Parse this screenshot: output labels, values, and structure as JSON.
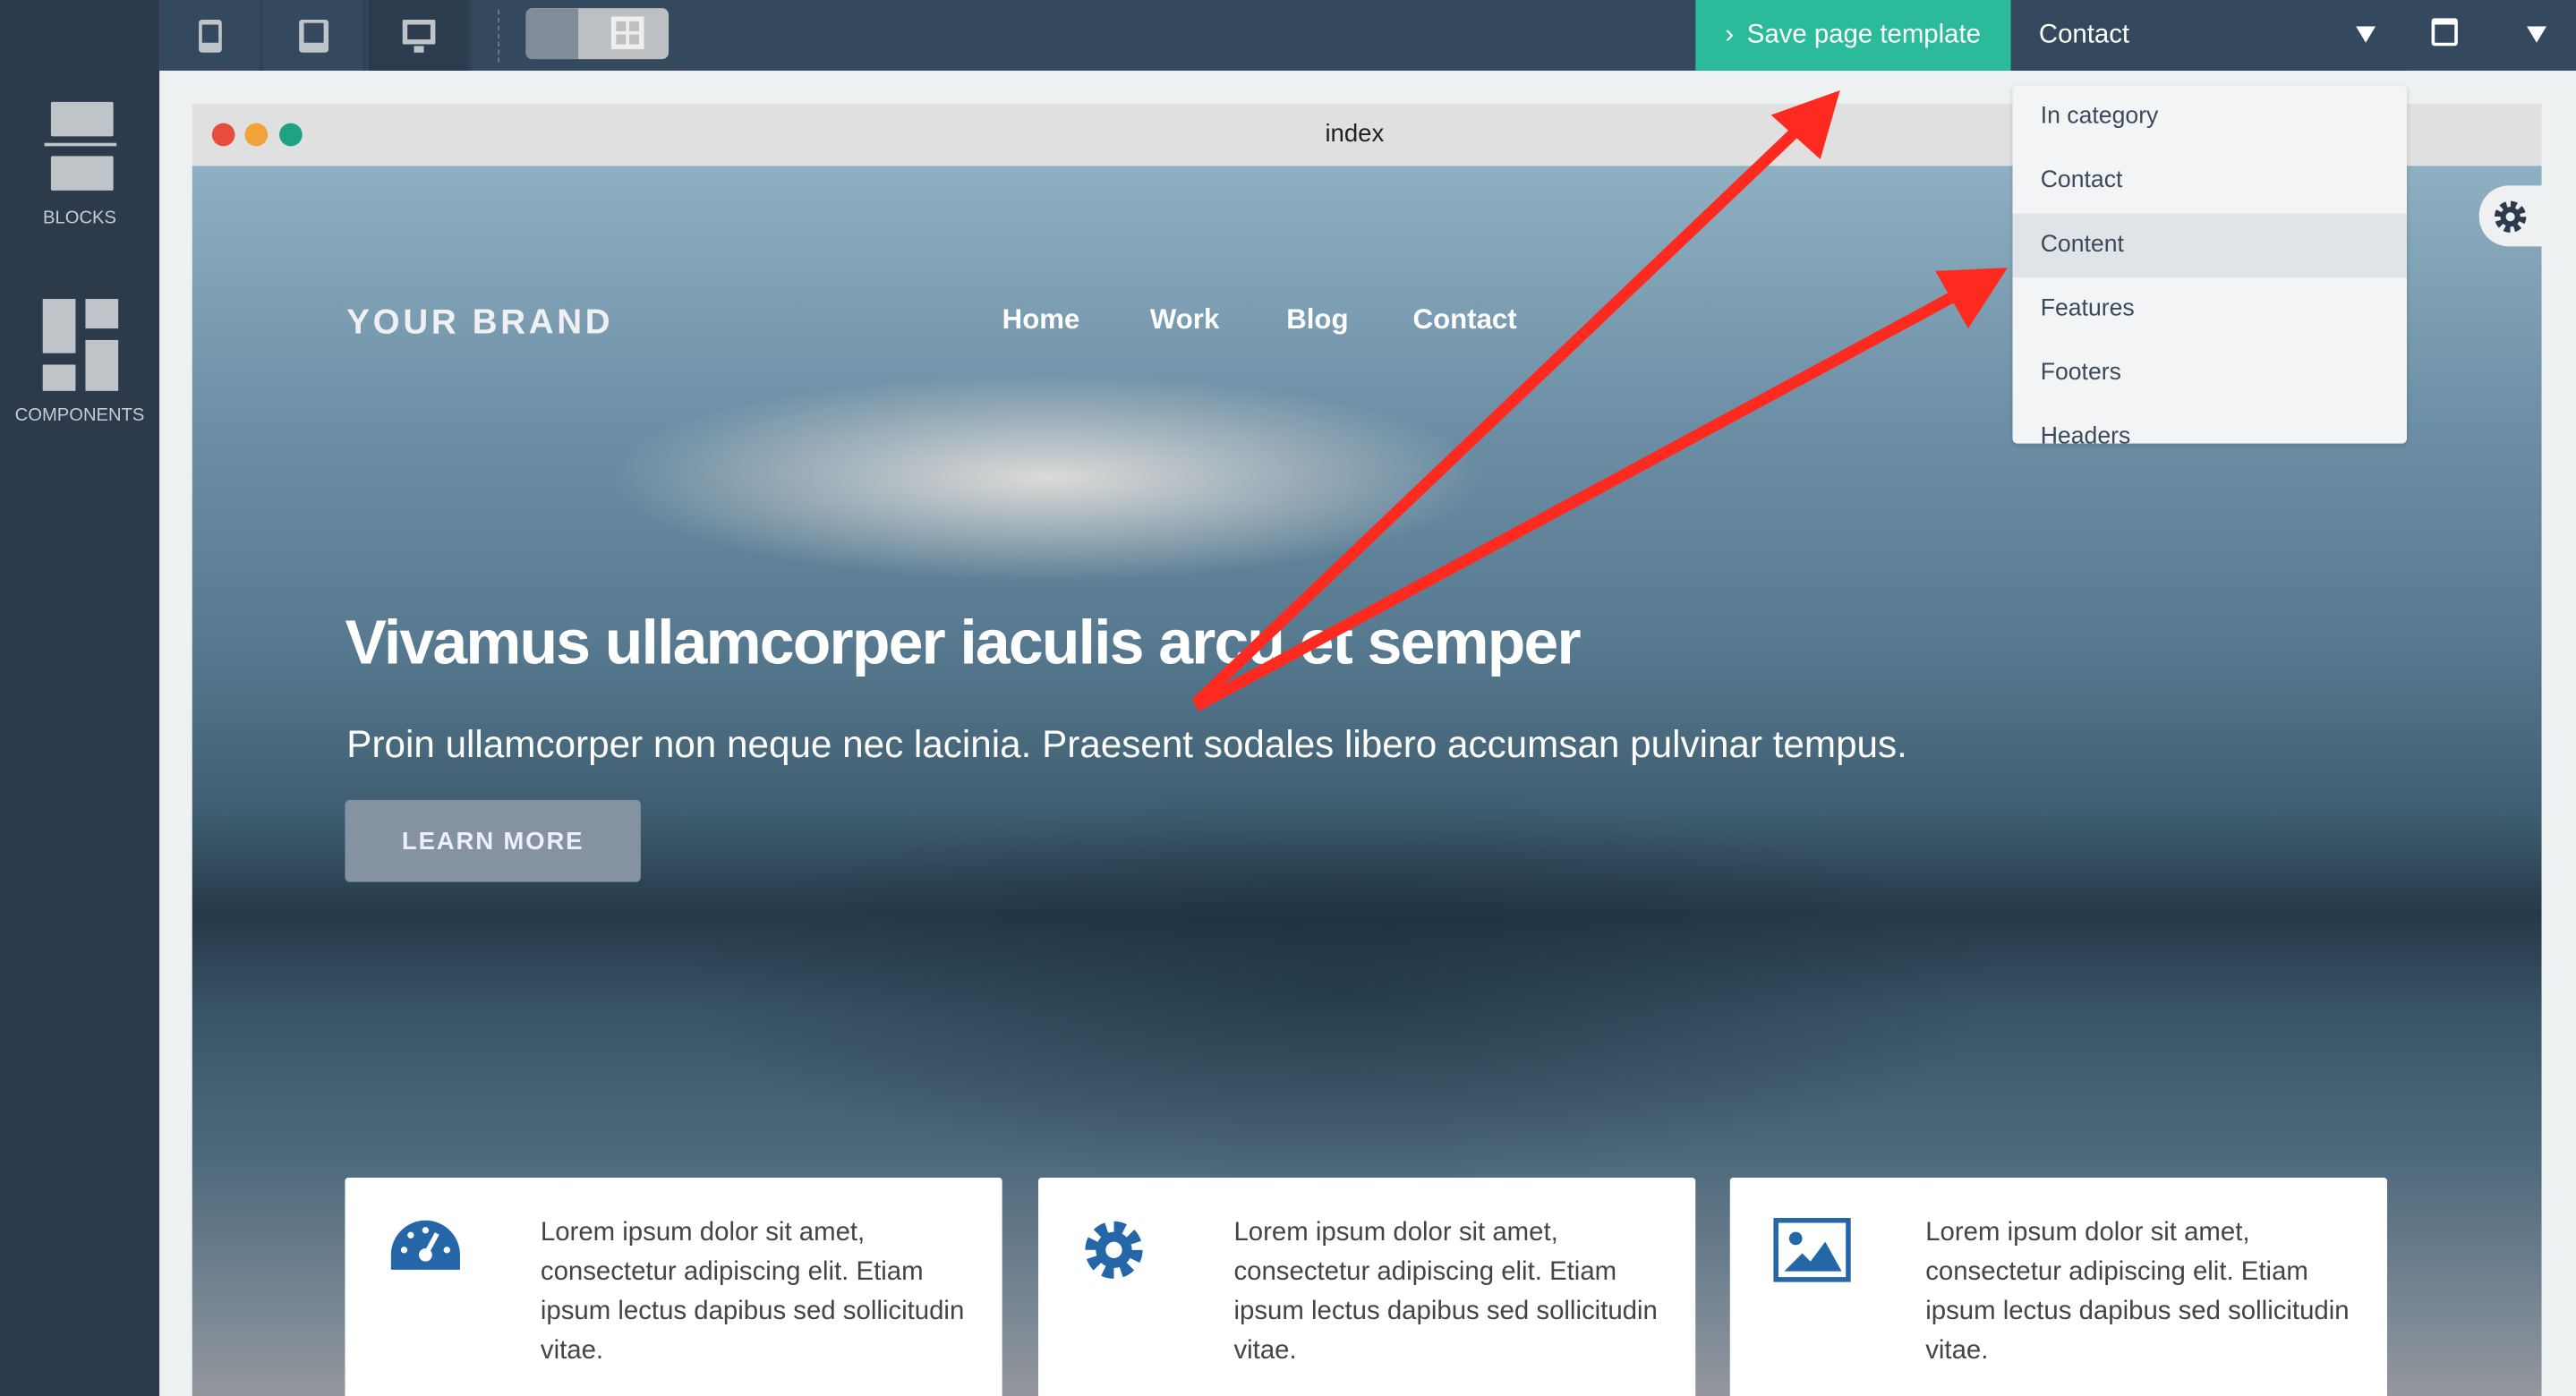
{
  "sidebar": {
    "items": [
      {
        "label": "BLOCKS",
        "icon": "blocks-icon"
      },
      {
        "label": "COMPONENTS",
        "icon": "components-icon"
      }
    ]
  },
  "toolbar": {
    "devices": [
      "mobile-icon",
      "tablet-icon",
      "desktop-icon"
    ],
    "active_device": "desktop",
    "save_label": "Save page template",
    "category_selected": "Contact"
  },
  "category_menu": {
    "items": [
      "In category",
      "Contact",
      "Content",
      "Features",
      "Footers",
      "Headers"
    ],
    "highlighted": "Content"
  },
  "frame": {
    "title": "index"
  },
  "page": {
    "brand": "YOUR BRAND",
    "nav": [
      "Home",
      "Work",
      "Blog",
      "Contact"
    ],
    "headline": "Vivamus ullamcorper iaculis arcu et semper",
    "subheadline": "Proin ullamcorper non neque nec lacinia. Praesent sodales libero accumsan pulvinar tempus.",
    "cta": "LEARN MORE",
    "cards": [
      {
        "icon": "dashboard-icon",
        "text": "Lorem ipsum dolor sit amet, consectetur adipiscing elit. Etiam ipsum lectus dapibus sed sollicitudin vitae."
      },
      {
        "icon": "gear-icon",
        "text": "Lorem ipsum dolor sit amet, consectetur adipiscing elit. Etiam ipsum lectus dapibus sed sollicitudin vitae."
      },
      {
        "icon": "image-icon",
        "text": "Lorem ipsum dolor sit amet, consectetur adipiscing elit. Etiam ipsum lectus dapibus sed sollicitudin vitae."
      }
    ]
  },
  "colors": {
    "accent": "#2bbb9b",
    "topbar": "#34495e",
    "sidebar": "#2c3a4c",
    "annotation": "#ff2a1f",
    "icon": "#2466a8"
  }
}
